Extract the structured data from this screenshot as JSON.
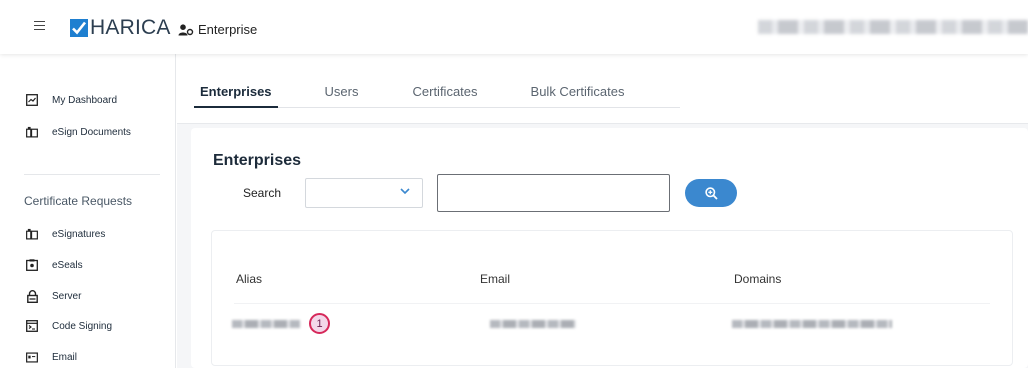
{
  "header": {
    "logo_text": "HARICA",
    "breadcrumb": "Enterprise"
  },
  "sidebar": {
    "items": [
      {
        "label": "My Dashboard",
        "icon": "dashboard-icon"
      },
      {
        "label": "eSign Documents",
        "icon": "document-sign-icon"
      }
    ],
    "section_title": "Certificate Requests",
    "cert_items": [
      {
        "label": "eSignatures",
        "icon": "signature-icon"
      },
      {
        "label": "eSeals",
        "icon": "seal-icon"
      },
      {
        "label": "Server",
        "icon": "lock-icon"
      },
      {
        "label": "Code Signing",
        "icon": "code-icon"
      },
      {
        "label": "Email",
        "icon": "email-icon"
      }
    ]
  },
  "tabs": [
    {
      "label": "Enterprises",
      "active": true
    },
    {
      "label": "Users",
      "active": false
    },
    {
      "label": "Certificates",
      "active": false
    },
    {
      "label": "Bulk Certificates",
      "active": false
    }
  ],
  "main": {
    "title": "Enterprises",
    "search_label": "Search",
    "search_value": "",
    "select_value": ""
  },
  "table": {
    "columns": [
      "Alias",
      "Email",
      "Domains"
    ],
    "rows": [
      {
        "badge": "1"
      }
    ]
  },
  "colors": {
    "accent": "#3b88cf",
    "brand": "#1e7fd0",
    "badge_border": "#d6285a"
  }
}
